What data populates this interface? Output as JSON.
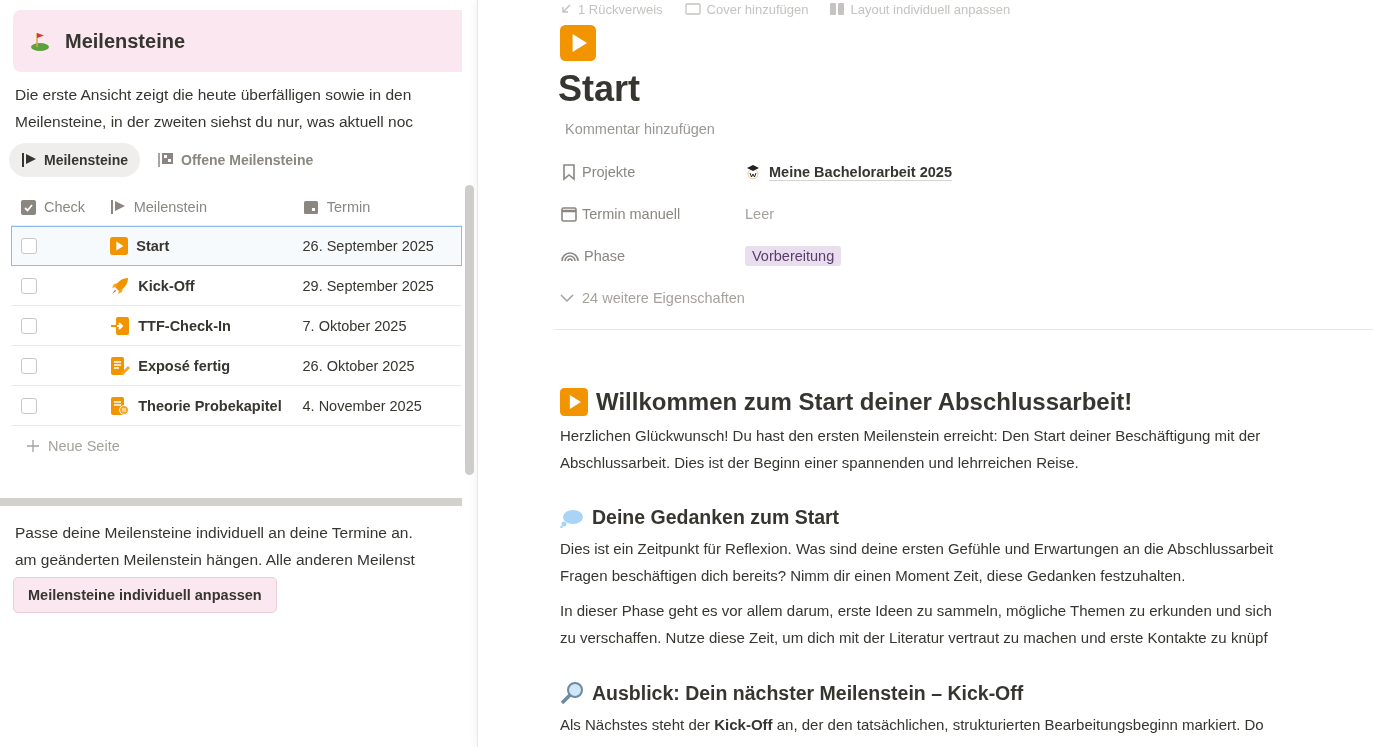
{
  "left": {
    "callout": {
      "title": "Meilensteine"
    },
    "intro_lines": [
      "Die erste Ansicht zeigt die heute überfälligen sowie in den",
      "Meilensteine, in der zweiten siehst du nur, was aktuell noc"
    ],
    "tabs": [
      {
        "label": "Meilensteine",
        "selected": true
      },
      {
        "label": "Offene Meilensteine",
        "selected": false
      }
    ],
    "table": {
      "columns": [
        "Check",
        "Meilenstein",
        "Termin"
      ],
      "rows": [
        {
          "checked": false,
          "selected": true,
          "name": "Start",
          "date": "26. September 2025"
        },
        {
          "checked": false,
          "selected": false,
          "name": "Kick-Off",
          "date": "29. September 2025"
        },
        {
          "checked": false,
          "selected": false,
          "name": "TTF-Check-In",
          "date": "7. Oktober 2025"
        },
        {
          "checked": false,
          "selected": false,
          "name": "Exposé fertig",
          "date": "26. Oktober 2025"
        },
        {
          "checked": false,
          "selected": false,
          "name": "Theorie Probekapitel",
          "date": "4. November 2025"
        }
      ],
      "new_row": "Neue Seite"
    },
    "note_lines": [
      "Passe deine Meilensteine individuell an deine Termine an.",
      "am geänderten Meilenstein hängen. Alle anderen Meilenst"
    ],
    "button": "Meilensteine individuell anpassen"
  },
  "page": {
    "toolbar": [
      "1 Rückverweis",
      "Cover hinzufügen",
      "Layout individuell anpassen"
    ],
    "title": "Start",
    "comment": "Kommentar hinzufügen",
    "properties": [
      {
        "kind": "relation",
        "label": "Projekte",
        "value": "Meine Bachelorarbeit 2025"
      },
      {
        "kind": "empty",
        "label": "Termin manuell",
        "value": "Leer"
      },
      {
        "kind": "tag",
        "label": "Phase",
        "value": "Vorbereitung"
      }
    ],
    "more_properties": "24 weitere Eigenschaften",
    "blocks": [
      {
        "kind": "h2",
        "text": "Willkommen zum Start deiner Abschlussarbeit!"
      },
      {
        "kind": "p",
        "lines": [
          "Herzlichen Glückwunsch! Du hast den ersten Meilenstein erreicht: Den Start deiner Beschäftigung mit der",
          "Abschlussarbeit. Dies ist der Beginn einer spannenden und lehrreichen Reise."
        ]
      },
      {
        "kind": "h3",
        "text": "Deine Gedanken zum Start"
      },
      {
        "kind": "p",
        "lines": [
          "Dies ist ein Zeitpunkt für Reflexion. Was sind deine ersten Gefühle und Erwartungen an die Abschlussarbeit",
          "Fragen beschäftigen dich bereits? Nimm dir einen Moment Zeit, diese Gedanken festzuhalten."
        ]
      },
      {
        "kind": "p",
        "lines": [
          "In dieser Phase geht es vor allem darum, erste Ideen zu sammeln, mögliche Themen zu erkunden und sich",
          "zu verschaffen. Nutze diese Zeit, um dich mit der Literatur vertraut zu machen und erste Kontakte zu knüpf"
        ]
      },
      {
        "kind": "h3",
        "text": "Ausblick: Dein nächster Meilenstein –  Kick-Off"
      },
      {
        "kind": "p",
        "lines": [
          "Als Nächstes steht der **Kick-Off** an, der den tatsächlichen, strukturierten Bearbeitungsbeginn markiert. Do"
        ]
      }
    ]
  }
}
